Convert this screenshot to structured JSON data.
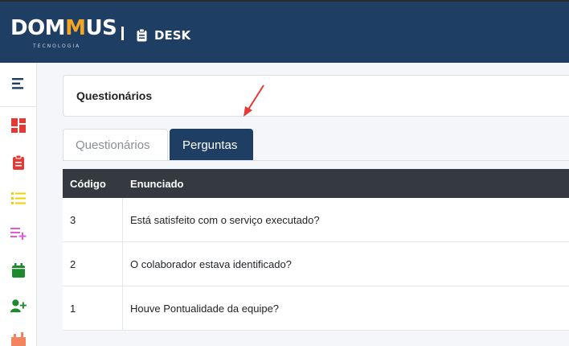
{
  "header": {
    "logo_main_pre": "DOM",
    "logo_main_accent": "M",
    "logo_main_post": "US",
    "logo_sub": "TECNOLOGIA",
    "app_label": "DESK"
  },
  "sidebar": {
    "icons": [
      "menu-icon",
      "dashboard-icon",
      "clipboard-icon",
      "list-icon",
      "playlist-add-icon",
      "calendar-icon",
      "add-user-icon",
      "building-icon"
    ]
  },
  "page": {
    "title": "Questionários",
    "tabs": [
      {
        "label": "Questionários",
        "active": false
      },
      {
        "label": "Perguntas",
        "active": true
      }
    ]
  },
  "table": {
    "headers": {
      "code": "Código",
      "text": "Enunciado"
    },
    "rows": [
      {
        "code": "3",
        "text": "Está satisfeito com o serviço executado?"
      },
      {
        "code": "2",
        "text": "O colaborador estava identificado?"
      },
      {
        "code": "1",
        "text": "Houve Pontualidade da equipe?"
      }
    ]
  },
  "colors": {
    "brand": "#1f3e64",
    "accent": "#f5a623",
    "table_header": "#343a40"
  }
}
